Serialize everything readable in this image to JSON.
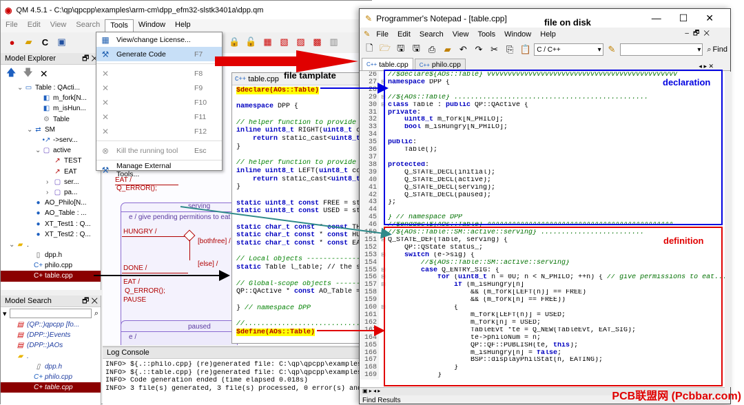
{
  "qm": {
    "title": "QM 4.5.1 - C:\\qp\\qpcpp\\examples\\arm-cm\\dpp_efm32-slstk3401a\\dpp.qm",
    "menus": [
      "File",
      "Edit",
      "View",
      "Search",
      "Tools",
      "Window",
      "Help"
    ],
    "explorer_title": "Model Explorer",
    "explorer_items": [
      {
        "label": "Table : QActi...",
        "icon": "class-icon"
      },
      {
        "label": "m_fork[N...",
        "icon": "attribute-icon"
      },
      {
        "label": "m_isHun...",
        "icon": "attribute-icon"
      },
      {
        "label": "Table",
        "icon": "constructor-icon"
      },
      {
        "label": "SM",
        "icon": "state-machine-icon"
      },
      {
        "label": "->serv...",
        "icon": "initial-transition-icon"
      },
      {
        "label": "active",
        "icon": "state-icon"
      },
      {
        "label": "TEST",
        "icon": "transition-icon"
      },
      {
        "label": "EAT",
        "icon": "transition-icon"
      },
      {
        "label": "ser...",
        "icon": "state-icon"
      },
      {
        "label": "pa...",
        "icon": "state-icon"
      },
      {
        "label": "AO_Philo[N...",
        "icon": "pointer-icon"
      },
      {
        "label": "AO_Table : ...",
        "icon": "pointer-icon"
      },
      {
        "label": "XT_Test1 : Q...",
        "icon": "pointer-icon"
      },
      {
        "label": "XT_Test2 : Q...",
        "icon": "pointer-icon"
      },
      {
        "label": ".",
        "icon": "folder-icon"
      },
      {
        "label": "dpp.h",
        "icon": "file-icon"
      },
      {
        "label": "philo.cpp",
        "icon": "cpp-file-icon"
      },
      {
        "label": "table.cpp",
        "icon": "cpp-file-icon"
      }
    ],
    "search_title": "Model Search",
    "search_items": [
      {
        "label": "(QP::)qpcpp [fo...",
        "icon": "package-icon"
      },
      {
        "label": "(DPP::)Events",
        "icon": "package-icon"
      },
      {
        "label": "(DPP::)AOs",
        "icon": "package-icon"
      },
      {
        "label": ".",
        "icon": "folder-icon"
      },
      {
        "label": "dpp.h",
        "icon": "file-icon"
      },
      {
        "label": "philo.cpp",
        "icon": "cpp-file-icon"
      },
      {
        "label": "table.cpp",
        "icon": "cpp-file-icon"
      }
    ],
    "tools_menu": [
      {
        "label": "View/change License...",
        "shortcut": "",
        "icon": "license-icon",
        "state": "normal"
      },
      {
        "label": "Generate Code",
        "shortcut": "F7",
        "icon": "generate-code-icon",
        "state": "highlighted"
      },
      {
        "label": "",
        "shortcut": "F8",
        "icon": "tool-icon",
        "state": "disabled"
      },
      {
        "label": "",
        "shortcut": "F9",
        "icon": "tool-icon",
        "state": "disabled"
      },
      {
        "label": "",
        "shortcut": "F10",
        "icon": "tool-icon",
        "state": "disabled"
      },
      {
        "label": "",
        "shortcut": "F11",
        "icon": "tool-icon",
        "state": "disabled"
      },
      {
        "label": "",
        "shortcut": "F12",
        "icon": "tool-icon",
        "state": "disabled"
      },
      {
        "label": "Kill the running tool",
        "shortcut": "Esc",
        "icon": "kill-icon",
        "state": "disabled"
      },
      {
        "label": "Manage External Tools...",
        "shortcut": "",
        "icon": "manage-tools-icon",
        "state": "normal"
      }
    ],
    "diagram": {
      "tr_eat": "EAT /",
      "tr_qerror1": "Q_ERROR();",
      "state_serving": "serving",
      "serving_entry": "e / give pending permitions to eat",
      "tr_hungry": "HUNGRY /",
      "tr_bothfree": "[bothfree] /",
      "tr_else": "[else] /",
      "tr_done": "DONE /",
      "tr_eat2": "EAT /",
      "tr_qerror2": "Q_ERROR();",
      "tr_pause": "PAUSE",
      "state_paused": "paused",
      "paused_entry": "e /"
    },
    "template": {
      "tab": "table.cpp",
      "lines": [
        "$declare(AOs::Table)",
        "",
        "namespace DPP {",
        "",
        "// helper function to provide",
        "inline uint8_t RIGHT(uint8_t c",
        "    return static_cast<uint8_t",
        "}",
        "",
        "// helper function to provide",
        "inline uint8_t LEFT(uint8_t co",
        "    return static_cast<uint8_t",
        "}",
        "",
        "static uint8_t const FREE = st",
        "static uint8_t const USED = st",
        "",
        "static char_t const * const TH",
        "static char_t const * const HU",
        "static char_t const * const EA",
        "",
        "// Local objects --------------",
        "static Table l_table; // the s",
        "",
        "// Global-scope objects -------",
        "QP::QActive * const AO_Table =",
        "",
        "} // namespace DPP",
        "",
        "//..............................",
        "$define(AOs::Table)"
      ]
    },
    "log": {
      "title": "Log Console",
      "lines": [
        "INFO> ${.::philo.cpp} (re)generated file: C:\\qp\\qpcpp\\examples",
        "INFO> ${.::table.cpp} (re)generated file: C:\\qp\\qpcpp\\examples",
        "INFO> Code generation ended (time elapsed 0.018s)",
        "INFO> 3 file(s) generated, 3 file(s) processed, 0 error(s) and"
      ]
    }
  },
  "pn": {
    "title": "Programmer's Notepad - [table.cpp]",
    "menus": [
      "File",
      "Edit",
      "Search",
      "View",
      "Tools",
      "Window",
      "Help"
    ],
    "scheme": "C / C++",
    "find_label": "Find",
    "tabs": [
      "table.cpp",
      "philo.cpp"
    ],
    "status": "Find Results",
    "lines": [
      {
        "n": "26",
        "c": "//$declare${AOs::Table} vvvvvvvvvvvvvvvvvvvvvvvvvvvvvvvvvvvvvvvvvvvvvv",
        "t": "mac"
      },
      {
        "n": "27",
        "c": "namespace DPP {",
        "t": "ns",
        "f": "−"
      },
      {
        "n": "28",
        "c": "",
        "t": ""
      },
      {
        "n": "29",
        "c": "//${AOs::Table} ...............................................",
        "t": "cm",
        "f": "−"
      },
      {
        "n": "30",
        "c": "class Table : public QP::QActive {",
        "t": "cls",
        "f": "−"
      },
      {
        "n": "31",
        "c": "private:",
        "t": "kw"
      },
      {
        "n": "32",
        "c": "    uint8_t m_fork[N_PHILO];",
        "t": ""
      },
      {
        "n": "33",
        "c": "    bool m_isHungry[N_PHILO];",
        "t": ""
      },
      {
        "n": "34",
        "c": "",
        "t": ""
      },
      {
        "n": "35",
        "c": "public:",
        "t": "kw"
      },
      {
        "n": "36",
        "c": "    Table();",
        "t": ""
      },
      {
        "n": "37",
        "c": "",
        "t": ""
      },
      {
        "n": "38",
        "c": "protected:",
        "t": "kw"
      },
      {
        "n": "39",
        "c": "    Q_STATE_DECL(initial);",
        "t": ""
      },
      {
        "n": "40",
        "c": "    Q_STATE_DECL(active);",
        "t": ""
      },
      {
        "n": "41",
        "c": "    Q_STATE_DECL(serving);",
        "t": ""
      },
      {
        "n": "42",
        "c": "    Q_STATE_DECL(paused);",
        "t": ""
      },
      {
        "n": "43",
        "c": "};",
        "t": ""
      },
      {
        "n": "44",
        "c": "",
        "t": ""
      },
      {
        "n": "45",
        "c": "} // namespace DPP",
        "t": "cm"
      },
      {
        "n": "46",
        "c": "//$enddecl${AOs::Table} ^^^^^^^^^^^^^^^^^^^^^^^^^^^^^^^^^^^^^^^^^^^^^",
        "t": "mac"
      },
      {
        "n": "150",
        "c": "//${AOs::Table::SM::active::serving} .........................",
        "t": "mac"
      },
      {
        "n": "151",
        "c": "Q_STATE_DEF(Table, serving) {",
        "t": "",
        "f": "−"
      },
      {
        "n": "152",
        "c": "    QP::QState status_;",
        "t": ""
      },
      {
        "n": "153",
        "c": "    switch (e->sig) {",
        "t": "sw",
        "f": "−"
      },
      {
        "n": "154",
        "c": "        //${AOs::Table::SM::active::serving}",
        "t": "cm"
      },
      {
        "n": "155",
        "c": "        case Q_ENTRY_SIG: {",
        "t": "case",
        "f": "−"
      },
      {
        "n": "156",
        "c": "            for (uint8_t n = 0U; n < N_PHILO; ++n) { // give permissions to eat...",
        "t": "for",
        "f": "−"
      },
      {
        "n": "157",
        "c": "                if (m_isHungry[n]",
        "t": "if",
        "f": "−"
      },
      {
        "n": "158",
        "c": "                    && (m_fork[LEFT(n)] == FREE)",
        "t": ""
      },
      {
        "n": "159",
        "c": "                    && (m_fork[n] == FREE))",
        "t": ""
      },
      {
        "n": "160",
        "c": "                {",
        "t": "",
        "f": "−"
      },
      {
        "n": "161",
        "c": "                    m_fork[LEFT(n)] = USED;",
        "t": ""
      },
      {
        "n": "162",
        "c": "                    m_fork[n] = USED;",
        "t": ""
      },
      {
        "n": "163",
        "c": "                    TableEvt *te = Q_NEW(TableEvt, EAT_SIG);",
        "t": ""
      },
      {
        "n": "164",
        "c": "                    te->philoNum = n;",
        "t": ""
      },
      {
        "n": "165",
        "c": "                    QP::QF::PUBLISH(te, this);",
        "t": ""
      },
      {
        "n": "166",
        "c": "                    m_isHungry[n] = false;",
        "t": ""
      },
      {
        "n": "167",
        "c": "                    BSP::displayPhilStat(n, EATING);",
        "t": ""
      },
      {
        "n": "168",
        "c": "                }",
        "t": ""
      },
      {
        "n": "169",
        "c": "            }",
        "t": ""
      }
    ]
  },
  "callouts": {
    "file_on_disk": "file on disk",
    "file_template": "file tamplate",
    "declaration": "declaration",
    "definition": "definition"
  },
  "watermark": "PCB联盟网 (Pcbbar.com)",
  "colors": {
    "declaration_box": "#0000e0",
    "definition_box": "#e00000",
    "arrow_red": "#e00000",
    "arrow_teal": "#2f8a8a",
    "selection": "#8b0000"
  }
}
